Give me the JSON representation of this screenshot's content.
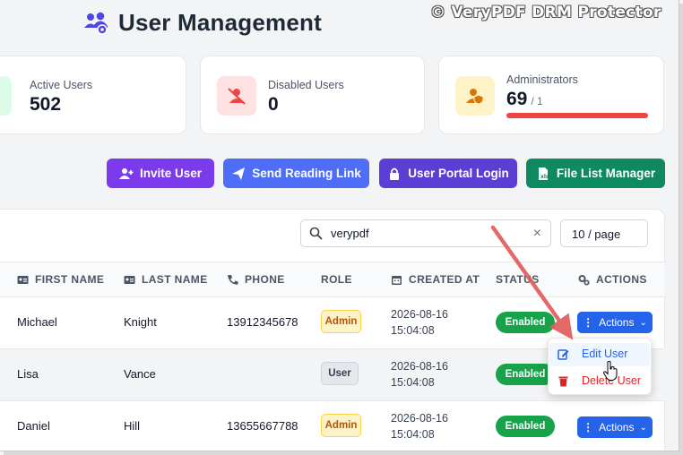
{
  "header": {
    "title": "User Management",
    "icon": "users-gear-icon"
  },
  "watermark": "© VeryPDF DRM Protector",
  "stats": [
    {
      "label": "Active Users",
      "value": "502",
      "icon": "user-check-icon",
      "color": "#16a34a"
    },
    {
      "label": "Disabled Users",
      "value": "0",
      "icon": "user-slash-icon",
      "color": "#ef4444"
    },
    {
      "label": "Administrators",
      "value": "69",
      "sub": "/ 1",
      "icon": "user-shield-icon",
      "color": "#d97706",
      "progress": 1.0
    }
  ],
  "toolbar": {
    "invite_label": "Invite User",
    "reading_link_label": "Send Reading Link",
    "portal_label": "User Portal Login",
    "file_manager_label": "File List Manager",
    "colors": {
      "invite": "#7c3aed",
      "reading_link": "#4f6ef7",
      "portal": "#5b3fd4",
      "file_manager": "#0f8a5f"
    }
  },
  "search": {
    "value": "verypdf",
    "clear": "×"
  },
  "page_size": "10 / page",
  "table": {
    "headers": [
      "FIRST NAME",
      "LAST NAME",
      "PHONE",
      "ROLE",
      "CREATED AT",
      "STATUS",
      "ACTIONS"
    ],
    "rows": [
      {
        "first": "Michael",
        "last": "Knight",
        "phone": "13912345678",
        "role": "Admin",
        "date": "2026-08-16",
        "time": "15:04:08",
        "status": "Enabled",
        "action": "Actions"
      },
      {
        "first": "Lisa",
        "last": "Vance",
        "phone": "",
        "role": "User",
        "date": "2026-08-16",
        "time": "15:04:08",
        "status": "Enabled",
        "action": ""
      },
      {
        "first": "Daniel",
        "last": "Hill",
        "phone": "13655667788",
        "role": "Admin",
        "date": "2026-08-16",
        "time": "15:04:08",
        "status": "Enabled",
        "action": "Actions"
      }
    ]
  },
  "dropdown": {
    "edit_label": "Edit User",
    "delete_label": "Delete User"
  }
}
